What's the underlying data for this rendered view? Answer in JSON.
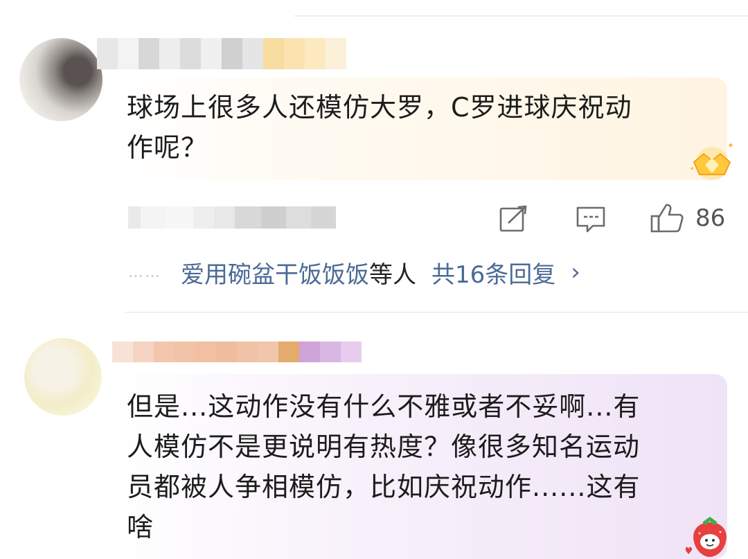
{
  "comment1": {
    "text_line1": "球场上很多人还模仿大罗，C罗进球庆祝动",
    "text_line2": "作呢？",
    "like_count": "86",
    "badge_icon": "crown-badge-icon"
  },
  "replies": {
    "dots": "……",
    "users": "爱用碗盆干饭饭饭",
    "tail": "等人",
    "total": "共16条回复",
    "chevron": "›"
  },
  "comment2": {
    "text_line1": "但是...这动作没有什么不雅或者不妥啊...有",
    "text_line2": "人模仿不是更说明有热度？像很多知名运动",
    "text_line3": "员都被人争相模仿，比如庆祝动作......这有",
    "text_line4": "啥",
    "badge_icon": "strawberry-badge-icon"
  },
  "icons": {
    "share": "share-icon",
    "comment": "comment-icon",
    "like": "thumbs-up-icon"
  },
  "colors": {
    "link_blue": "#4b6a96",
    "bubble1_tint": "#fff4e2",
    "bubble2_tint": "#efe3f6"
  }
}
